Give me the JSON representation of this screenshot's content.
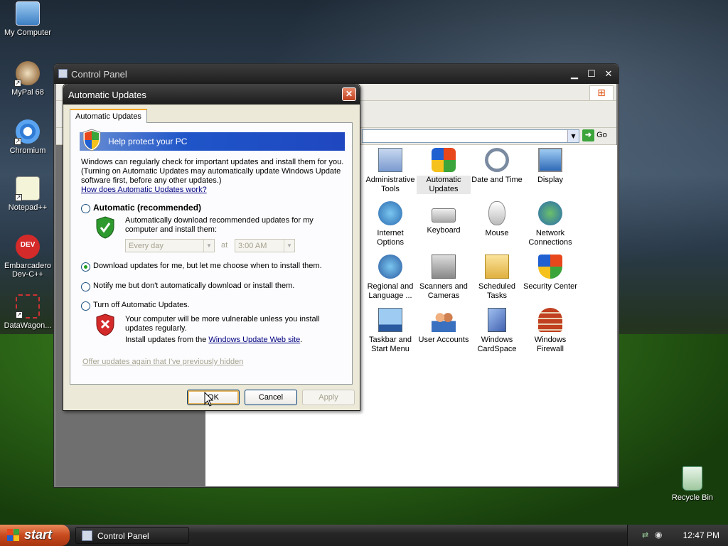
{
  "desktop": {
    "icons": [
      {
        "label": "My Computer"
      },
      {
        "label": "MyPal 68"
      },
      {
        "label": "Chromium"
      },
      {
        "label": "Notepad++"
      },
      {
        "label": "Embarcadero Dev-C++"
      },
      {
        "label": "DataWagon..."
      },
      {
        "label": "Recycle Bin"
      }
    ]
  },
  "control_panel": {
    "title": "Control Panel",
    "go_label": "Go",
    "items": [
      {
        "label": "Administrative Tools"
      },
      {
        "label": "Automatic Updates"
      },
      {
        "label": "Date and Time"
      },
      {
        "label": "Display"
      },
      {
        "label": "Internet Options"
      },
      {
        "label": "Keyboard"
      },
      {
        "label": "Mouse"
      },
      {
        "label": "Network Connections"
      },
      {
        "label": "Regional and Language ..."
      },
      {
        "label": "Scanners and Cameras"
      },
      {
        "label": "Scheduled Tasks"
      },
      {
        "label": "Security Center"
      },
      {
        "label": "Taskbar and Start Menu"
      },
      {
        "label": "User Accounts"
      },
      {
        "label": "Windows CardSpace"
      },
      {
        "label": "Windows Firewall"
      }
    ]
  },
  "dialog": {
    "title": "Automatic Updates",
    "tab": "Automatic Updates",
    "banner": "Help protect your PC",
    "intro": "Windows can regularly check for important updates and install them for you. (Turning on Automatic Updates may automatically update Windows Update software first, before any other updates.)",
    "how_link": "How does Automatic Updates work?",
    "opt_auto": "Automatic (recommended)",
    "opt_auto_desc": "Automatically download recommended updates for my computer and install them:",
    "freq_value": "Every day",
    "at_label": "at",
    "time_value": "3:00 AM",
    "opt_download": "Download updates for me, but let me choose when to install them.",
    "opt_notify": "Notify me but don't automatically download or install them.",
    "opt_off": "Turn off Automatic Updates.",
    "off_warning": "Your computer will be more vulnerable unless you install updates regularly.",
    "install_from": "Install updates from the",
    "wu_link": "Windows Update Web site",
    "hidden_link": "Offer updates again that I've previously hidden",
    "ok": "OK",
    "cancel": "Cancel",
    "apply": "Apply",
    "selected_option": "download"
  },
  "taskbar": {
    "start": "start",
    "task": "Control Panel",
    "time": "12:47 PM"
  },
  "colors": {
    "banner": "#1f55c8",
    "radio_dot": "#21a121",
    "start": "#c84a1e"
  }
}
